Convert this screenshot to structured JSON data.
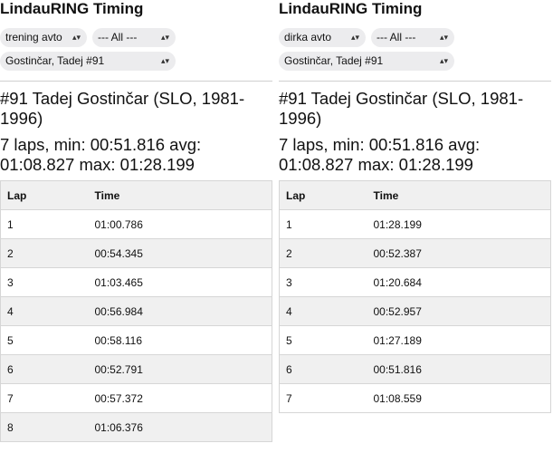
{
  "panels": [
    {
      "title": "LindauRING Timing",
      "session": "trening avto",
      "class": "--- All ---",
      "driver": "Gostinčar, Tadej #91",
      "heading": "#91 Tadej Gostinčar (SLO, 1981-1996)",
      "stats": "7 laps, min: 00:51.816 avg: 01:08.827 max: 01:28.199",
      "columns": [
        "Lap",
        "Time"
      ],
      "laps": [
        {
          "lap": "1",
          "time": "01:00.786"
        },
        {
          "lap": "2",
          "time": "00:54.345"
        },
        {
          "lap": "3",
          "time": "01:03.465"
        },
        {
          "lap": "4",
          "time": "00:56.984"
        },
        {
          "lap": "5",
          "time": "00:58.116"
        },
        {
          "lap": "6",
          "time": "00:52.791"
        },
        {
          "lap": "7",
          "time": "00:57.372"
        },
        {
          "lap": "8",
          "time": "01:06.376"
        }
      ]
    },
    {
      "title": "LindauRING Timing",
      "session": "dirka avto",
      "class": "--- All ---",
      "driver": "Gostinčar, Tadej #91",
      "heading": "#91 Tadej Gostinčar (SLO, 1981-1996)",
      "stats": "7 laps, min: 00:51.816 avg: 01:08.827 max: 01:28.199",
      "columns": [
        "Lap",
        "Time"
      ],
      "laps": [
        {
          "lap": "1",
          "time": "01:28.199"
        },
        {
          "lap": "2",
          "time": "00:52.387"
        },
        {
          "lap": "3",
          "time": "01:20.684"
        },
        {
          "lap": "4",
          "time": "00:52.957"
        },
        {
          "lap": "5",
          "time": "01:27.189"
        },
        {
          "lap": "6",
          "time": "00:51.816"
        },
        {
          "lap": "7",
          "time": "01:08.559"
        }
      ]
    }
  ]
}
